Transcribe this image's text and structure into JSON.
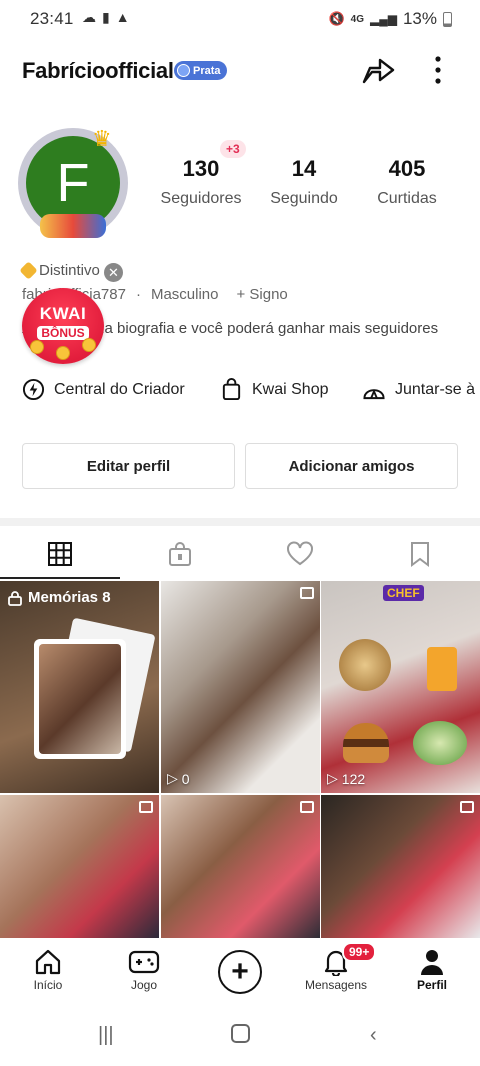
{
  "status_bar": {
    "time": "23:41",
    "battery": "13%",
    "icons": [
      "cloud-icon",
      "sim-icon",
      "warning-icon",
      "mute-icon",
      "4g-icon",
      "signal-icon",
      "battery-icon"
    ]
  },
  "header": {
    "username": "Fabrícioofficial",
    "tier_badge": "Prata"
  },
  "avatar": {
    "initial": "F"
  },
  "stats": {
    "followers": {
      "value": "130",
      "label": "Seguidores",
      "delta": "+3"
    },
    "following": {
      "value": "14",
      "label": "Seguindo"
    },
    "likes": {
      "value": "405",
      "label": "Curtidas"
    }
  },
  "profile": {
    "badge_label": "Distintivo",
    "handle": "fabriciofficia787",
    "gender": "Masculino",
    "sign": "+ Signo",
    "bio_prompt": "Adicione uma biografia e você poderá ganhar mais seguidores"
  },
  "kwai_bonus": {
    "line1": "KWAI",
    "line2": "BÔNUS"
  },
  "actions": [
    {
      "label": "Central do Criador",
      "icon": "lightning-icon"
    },
    {
      "label": "Kwai Shop",
      "icon": "bag-icon"
    },
    {
      "label": "Juntar-se à",
      "icon": "tent-icon"
    }
  ],
  "buttons": {
    "edit": "Editar perfil",
    "add_friends": "Adicionar amigos"
  },
  "tabs": [
    "grid-icon",
    "locked-bag-icon",
    "heart-icon",
    "bookmark-icon"
  ],
  "grid": {
    "memories_label": "Memórias 8",
    "items": [
      {
        "plays": "0"
      },
      {
        "plays": "122",
        "overlay_text": "CHEF"
      }
    ]
  },
  "bottom_nav": {
    "items": [
      {
        "label": "Início",
        "icon": "home-icon"
      },
      {
        "label": "Jogo",
        "icon": "gamepad-icon"
      },
      {
        "label": "",
        "icon": "plus-icon"
      },
      {
        "label": "Mensagens",
        "icon": "bell-icon",
        "badge": "99+"
      },
      {
        "label": "Perfil",
        "icon": "person-icon"
      }
    ]
  },
  "colors": {
    "accent_red": "#e3213d",
    "avatar_green": "#2e7d1f",
    "tier_blue": "#4a73d6"
  }
}
